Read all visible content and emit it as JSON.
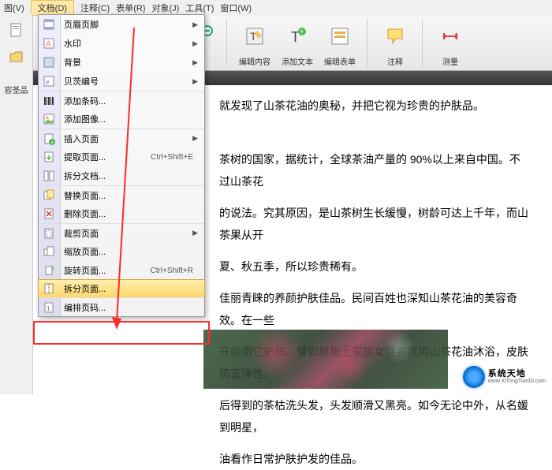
{
  "menubar": {
    "items": [
      "图(V)",
      "文档(D)",
      "注释(C)",
      "表单(R)",
      "对象(J)",
      "工具(T)",
      "窗口(W)"
    ],
    "active_index": 1
  },
  "toolbar": {
    "edit_content": "编辑内容",
    "add_text": "添加文本",
    "edit_form": "编辑表单",
    "annotate": "注释",
    "measure": "测量"
  },
  "status_left": "容圣品",
  "dropdown": {
    "items": [
      {
        "label": "页眉页脚",
        "icon": "header-footer-icon",
        "arrow": true,
        "sep": false
      },
      {
        "label": "水印",
        "icon": "watermark-icon",
        "arrow": true,
        "sep": false
      },
      {
        "label": "背景",
        "icon": "background-icon",
        "arrow": true,
        "sep": false
      },
      {
        "label": "贝茨编号",
        "icon": "bates-icon",
        "arrow": true,
        "sep": false
      },
      {
        "label": "添加条码...",
        "icon": "barcode-icon",
        "arrow": false,
        "sep": true
      },
      {
        "label": "添加图像...",
        "icon": "image-icon",
        "arrow": false,
        "sep": false
      },
      {
        "label": "插入页面",
        "icon": "insert-page-icon",
        "arrow": true,
        "sep": true
      },
      {
        "label": "提取页面...",
        "icon": "extract-page-icon",
        "arrow": false,
        "sep": false,
        "shortcut": "Ctrl+Shift+E"
      },
      {
        "label": "拆分文档...",
        "icon": "split-doc-icon",
        "arrow": false,
        "sep": false
      },
      {
        "label": "替换页面...",
        "icon": "replace-page-icon",
        "arrow": false,
        "sep": true
      },
      {
        "label": "删除页面...",
        "icon": "delete-page-icon",
        "arrow": false,
        "sep": false
      },
      {
        "label": "裁剪页面",
        "icon": "crop-page-icon",
        "arrow": true,
        "sep": true
      },
      {
        "label": "缩放页面...",
        "icon": "scale-page-icon",
        "arrow": false,
        "sep": false
      },
      {
        "label": "旋转页面...",
        "icon": "rotate-page-icon",
        "arrow": false,
        "sep": false,
        "shortcut": "Ctrl+Shift+R"
      },
      {
        "label": "拆分页面...",
        "icon": "split-page-icon",
        "arrow": false,
        "sep": true,
        "highlighted": true
      },
      {
        "label": "编排页码...",
        "icon": "number-page-icon",
        "arrow": false,
        "sep": true
      }
    ]
  },
  "content": {
    "p1": "就发现了山茶花油的奥秘，并把它视为珍贵的护肤品。",
    "p2": "茶树的国家，据统计，全球茶油产量的 90%以上来自中国。不过山茶花",
    "p3": "的说法。究其原因，是山茶树生长缓慢，树龄可达上千年，而山茶果从开",
    "p4": "夏、秋五季，所以珍贵稀有。",
    "p5": "佳丽青睐的养颜护肤佳品。民间百姓也深知山茶花油的美容奇效。在一些",
    "p6": "开始用它护肤。譬如恩施土家族女性喜欢用山茶花油沐浴，皮肤极富弹性，",
    "p7": "后得到的茶枯洗头发，头发顺滑又黑亮。如今无论中外，从名媛到明星，",
    "p8": "油看作日常护肤护发的佳品。"
  },
  "brand": {
    "cn": "系统天地",
    "en": "www.XiTongTianDi.com"
  }
}
